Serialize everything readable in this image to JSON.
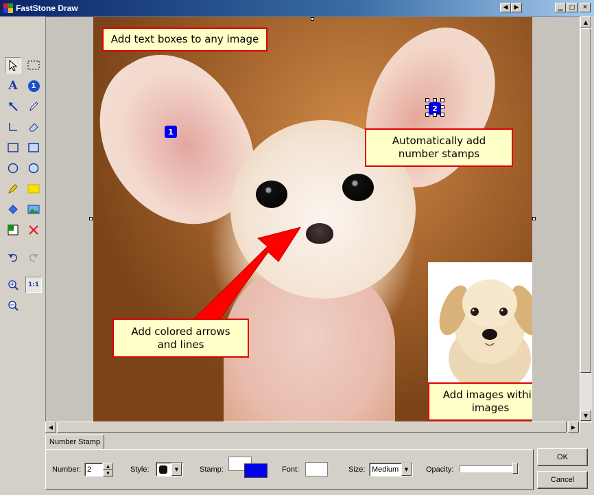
{
  "window": {
    "title": "FastStone Draw"
  },
  "canvas": {
    "callouts": {
      "text_boxes": "Add text boxes to any image",
      "number_stamps_line1": "Automatically add",
      "number_stamps_line2": "number stamps",
      "arrows_line1": "Add colored arrows",
      "arrows_line2": "and lines",
      "images_line1": "Add images within",
      "images_line2": "images"
    },
    "stamps": [
      "1",
      "2"
    ]
  },
  "bottom_panel": {
    "tab_label": "Number Stamp",
    "number_label": "Number:",
    "number_value": "2",
    "style_label": "Style:",
    "stamp_label": "Stamp:",
    "font_label": "Font:",
    "size_label": "Size:",
    "size_value": "Medium",
    "opacity_label": "Opacity:",
    "opacity_level": 1.0
  },
  "buttons": {
    "ok": "OK",
    "cancel": "Cancel",
    "zoom_actual": "1:1"
  },
  "colors": {
    "stamp_color": "#0000ee",
    "callout_border": "#e00000",
    "callout_fill": "#ffffc8",
    "arrow_color": "#ff0000"
  }
}
